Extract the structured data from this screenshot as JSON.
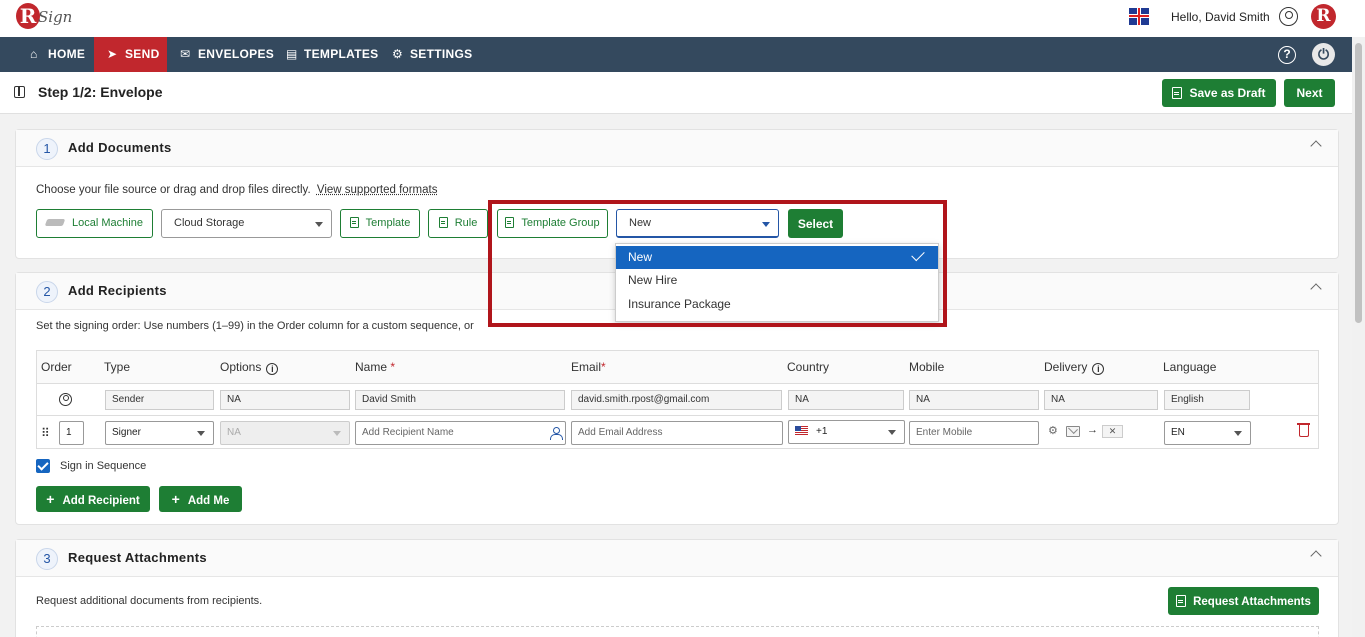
{
  "app": {
    "logo_text": "Sign",
    "greeting": "Hello, David Smith",
    "brand_initial": "R"
  },
  "nav": {
    "items": [
      {
        "label": "HOME",
        "icon": "home-icon"
      },
      {
        "label": "SEND",
        "icon": "send-icon",
        "active": true
      },
      {
        "label": "ENVELOPES",
        "icon": "envelope-icon"
      },
      {
        "label": "TEMPLATES",
        "icon": "template-icon"
      },
      {
        "label": "SETTINGS",
        "icon": "gear-icon"
      }
    ],
    "help_glyph": "?",
    "power_glyph": "⏻"
  },
  "step": {
    "title": "Step 1/2: Envelope",
    "save_draft_label": "Save as Draft",
    "next_label": "Next"
  },
  "add_documents": {
    "number": "1",
    "title": "Add Documents",
    "instructions": "Choose your file source or drag and drop files directly.",
    "formats_link": "View supported formats",
    "local_machine_label": "Local Machine",
    "cloud_storage_value": "Cloud Storage",
    "template_label": "Template",
    "rule_label": "Rule",
    "template_group_label": "Template Group",
    "group_select_value": "New",
    "select_button_label": "Select",
    "dropdown_options": [
      "New",
      "New Hire",
      "Insurance Package"
    ],
    "dropdown_selected": "New"
  },
  "add_recipients": {
    "number": "2",
    "title": "Add Recipients",
    "instructions_visible": "Set the signing order: Use numbers (1–99) in the Order column for a custom sequence, or",
    "columns": [
      "Order",
      "Type",
      "Options",
      "Name",
      "Email",
      "Country",
      "Mobile",
      "Delivery",
      "Language"
    ],
    "required_mark": "*",
    "sender_row": {
      "type": "Sender",
      "options": "NA",
      "name": "David Smith",
      "email": "david.smith.rpost@gmail.com",
      "country": "NA",
      "mobile": "NA",
      "delivery": "NA",
      "language": "English"
    },
    "signer_row": {
      "order": "1",
      "type": "Signer",
      "options": "NA",
      "name_placeholder": "Add Recipient Name",
      "email_placeholder": "Add Email Address",
      "country_code": "+1",
      "mobile_placeholder": "Enter Mobile",
      "language": "EN"
    },
    "sign_in_sequence_label": "Sign in Sequence",
    "sign_in_sequence_checked": true,
    "add_recipient_label": "Add Recipient",
    "add_me_label": "Add Me"
  },
  "request_attachments": {
    "number": "3",
    "title": "Request Attachments",
    "instructions": "Request additional documents from recipients.",
    "button_label": "Request Attachments"
  },
  "colors": {
    "brand_red": "#c1272d",
    "nav_bg": "#34495e",
    "green": "#1e7e34",
    "selection_blue": "#1565c0",
    "highlight_border": "#b0151b"
  }
}
